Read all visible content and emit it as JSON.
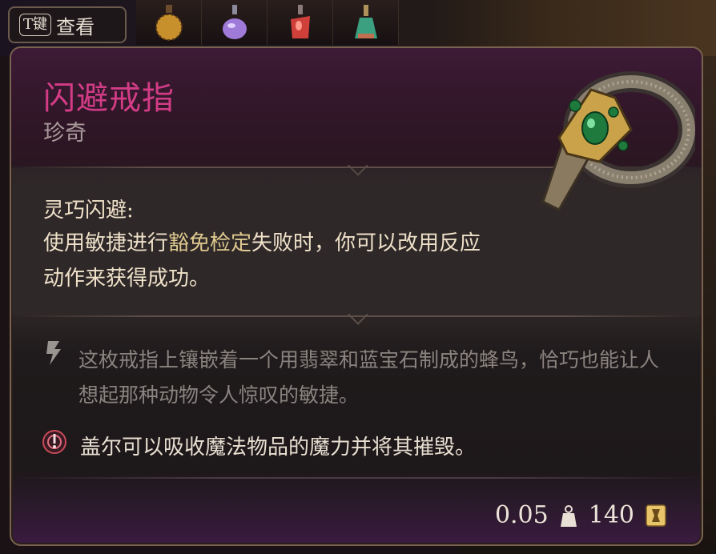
{
  "hotkey": {
    "key": "T键",
    "label": "查看"
  },
  "hotbar": {
    "items": [
      "gold-potion-icon",
      "purple-potion-icon",
      "red-potion-icon",
      "green-potion-icon"
    ]
  },
  "item": {
    "name": "闪避戒指",
    "rarity": "珍奇",
    "passive_name": "灵巧闪避:",
    "passive_desc_pre": "使用敏捷进行",
    "passive_desc_highlight": "豁免检定",
    "passive_desc_post": "失败时，你可以改用反应动作来获得成功。",
    "flavor": "这枚戒指上镶嵌着一个用翡翠和蓝宝石制成的蜂鸟，恰巧也能让人想起那种动物令人惊叹的敏捷。",
    "gale_note": "盖尔可以吸收魔法物品的魔力并将其摧毁。",
    "weight": "0.05",
    "value": "140"
  },
  "colors": {
    "title": "#d23c86",
    "highlight": "#dfc98f",
    "text": "#efe1c9",
    "flavor": "#8a8380"
  }
}
